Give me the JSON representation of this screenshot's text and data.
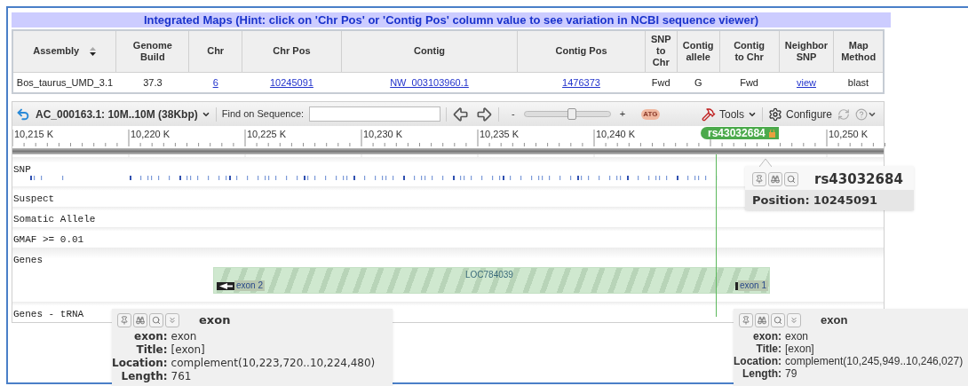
{
  "title": "Integrated Maps (Hint: click on 'Chr Pos' or 'Contig Pos' column value to see variation in NCBI sequence viewer)",
  "table": {
    "columns": [
      {
        "label": "Assembly",
        "sortable": true
      },
      {
        "label": "Genome Build",
        "sortable": false
      },
      {
        "label": "Chr",
        "sortable": false
      },
      {
        "label": "Chr Pos",
        "sortable": false
      },
      {
        "label": "Contig",
        "sortable": false
      },
      {
        "label": "Contig Pos",
        "sortable": false
      },
      {
        "label": "SNP to Chr",
        "sortable": false
      },
      {
        "label": "Contig allele",
        "sortable": false
      },
      {
        "label": "Contig to Chr",
        "sortable": false
      },
      {
        "label": "Neighbor SNP",
        "sortable": false
      },
      {
        "label": "Map Method",
        "sortable": false
      }
    ],
    "rows": [
      {
        "cells": [
          {
            "text": "Bos_taurus_UMD_3.1",
            "link": false
          },
          {
            "text": "37.3",
            "link": false
          },
          {
            "text": "6",
            "link": true
          },
          {
            "text": "10245091",
            "link": true
          },
          {
            "text": "NW_003103960.1",
            "link": true
          },
          {
            "text": "1476373",
            "link": true
          },
          {
            "text": "Fwd",
            "link": false
          },
          {
            "text": "G",
            "link": false
          },
          {
            "text": "Fwd",
            "link": false
          },
          {
            "text": "view",
            "link": true
          },
          {
            "text": "blast",
            "link": false
          }
        ]
      }
    ]
  },
  "viewer": {
    "sequence": "AC_000163.1: 10M..10M (38Kbp)",
    "find_label": "Find on Sequence:",
    "zoom_minus": "-",
    "zoom_plus": "+",
    "zoom": {
      "level": 0.55
    },
    "sequence_badge": "ATG",
    "tools": "Tools",
    "configure": "Configure",
    "ruler": [
      {
        "kind": "tick",
        "label": "10,215 K"
      },
      {
        "kind": "tick",
        "label": "10,220 K"
      },
      {
        "kind": "tick",
        "label": "10,225 K"
      },
      {
        "kind": "tick",
        "label": "10,230 K"
      },
      {
        "kind": "tick",
        "label": "10,235 K"
      },
      {
        "kind": "tick",
        "label": "10,240 K"
      },
      {
        "kind": "marker",
        "label": "rs43032684"
      },
      {
        "kind": "tick",
        "label": "10,250 K"
      }
    ],
    "tracks": [
      {
        "kind": "snp",
        "name": "SNP"
      },
      {
        "kind": "plain",
        "name": "Suspect"
      },
      {
        "kind": "plain",
        "name": "Somatic Allele"
      },
      {
        "kind": "plain",
        "name": "GMAF >= 0.01"
      },
      {
        "kind": "genes",
        "name": "Genes",
        "gene": {
          "name": "LOC784039",
          "exons": [
            "exon 2",
            "exon 1"
          ]
        }
      },
      {
        "kind": "plain",
        "name": "Genes - tRNA"
      }
    ]
  },
  "popups": [
    {
      "kind": "snp",
      "title": "rs43032684",
      "fields": [
        {
          "label": "Position:",
          "value": "10245091"
        }
      ]
    },
    {
      "kind": "feature",
      "title": "exon",
      "fields": [
        {
          "label": "exon:",
          "value": "exon"
        },
        {
          "label": "Title:",
          "value": "[exon]"
        },
        {
          "label": "Location:",
          "value": "complement(10,223,720..10,224,480)"
        },
        {
          "label": "Length:",
          "value": "761"
        }
      ]
    },
    {
      "kind": "feature",
      "title": "exon",
      "fields": [
        {
          "label": "exon:",
          "value": "exon"
        },
        {
          "label": "Title:",
          "value": "[exon]"
        },
        {
          "label": "Location:",
          "value": "complement(10,245,949..10,246,027)"
        },
        {
          "label": "Length:",
          "value": "79"
        }
      ]
    }
  ]
}
